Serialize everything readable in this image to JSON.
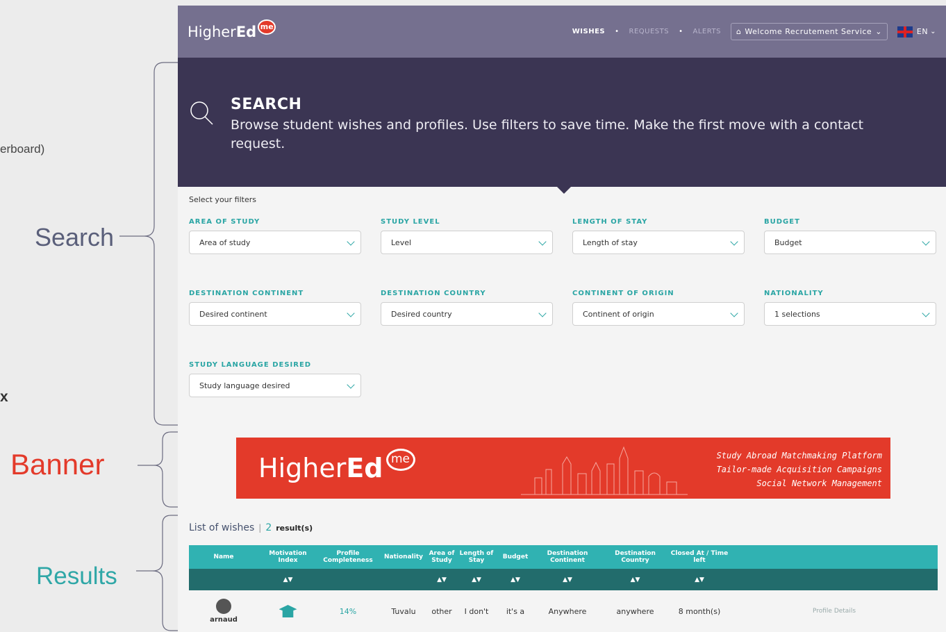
{
  "annotations": {
    "frag_text": "erboard)",
    "frag_x": "x",
    "search": "Search",
    "banner": "Banner",
    "results": "Results"
  },
  "topbar": {
    "logo_prefix": "Higher",
    "logo_bold": "Ed",
    "logo_bubble": "me",
    "nav": [
      "WISHES",
      "REQUESTS",
      "ALERTS"
    ],
    "welcome": "Welcome Recrutement Service",
    "lang": "EN"
  },
  "hero": {
    "title": "SEARCH",
    "desc": "Browse student wishes and profiles. Use filters to save time. Make the first move with a contact request."
  },
  "filters": {
    "select_title": "Select your filters",
    "items": [
      {
        "label": "AREA OF STUDY",
        "value": "Area of study"
      },
      {
        "label": "STUDY LEVEL",
        "value": "Level"
      },
      {
        "label": "LENGTH OF STAY",
        "value": "Length of stay"
      },
      {
        "label": "BUDGET",
        "value": "Budget"
      },
      {
        "label": "DESTINATION CONTINENT",
        "value": "Desired continent"
      },
      {
        "label": "DESTINATION COUNTRY",
        "value": "Desired country"
      },
      {
        "label": "CONTINENT OF ORIGIN",
        "value": "Continent of origin"
      },
      {
        "label": "NATIONALITY",
        "value": "1 selections"
      },
      {
        "label": "STUDY LANGUAGE DESIRED",
        "value": "Study language desired"
      }
    ]
  },
  "banner": {
    "logo_prefix": "Higher",
    "logo_bold": "Ed",
    "logo_bubble": "me",
    "taglines": [
      "Study Abroad Matchmaking Platform",
      "Tailor-made Acquisition Campaigns",
      "Social Network Management"
    ]
  },
  "results": {
    "title": "List of wishes",
    "count": "2",
    "unit": "result(s)",
    "columns": [
      "Name",
      "Motivation Index",
      "Profile Completeness",
      "Nationality",
      "Area of Study",
      "Length of Stay",
      "Budget",
      "Destination Continent",
      "Destination Country",
      "Closed At / Time left",
      ""
    ],
    "sort_marks": [
      "",
      "▲▼",
      "",
      "",
      "▲▼",
      "▲▼",
      "▲▼",
      "▲▼",
      "▲▼",
      "▲▼",
      ""
    ],
    "row": {
      "name": "arnaud",
      "completeness": "14%",
      "nationality": "Tuvalu",
      "area": "other",
      "stay": "I don't",
      "budget": "it's a",
      "continent": "Anywhere",
      "country": "anywhere",
      "time_left": "8 month(s)",
      "action": "Profile Details"
    }
  },
  "colors": {
    "topbar": "#75708f",
    "hero": "#3b3553",
    "accent": "#2aa5a4",
    "banner": "#e33a2a",
    "table_header": "#30b2b2",
    "table_sort": "#226c6c"
  }
}
